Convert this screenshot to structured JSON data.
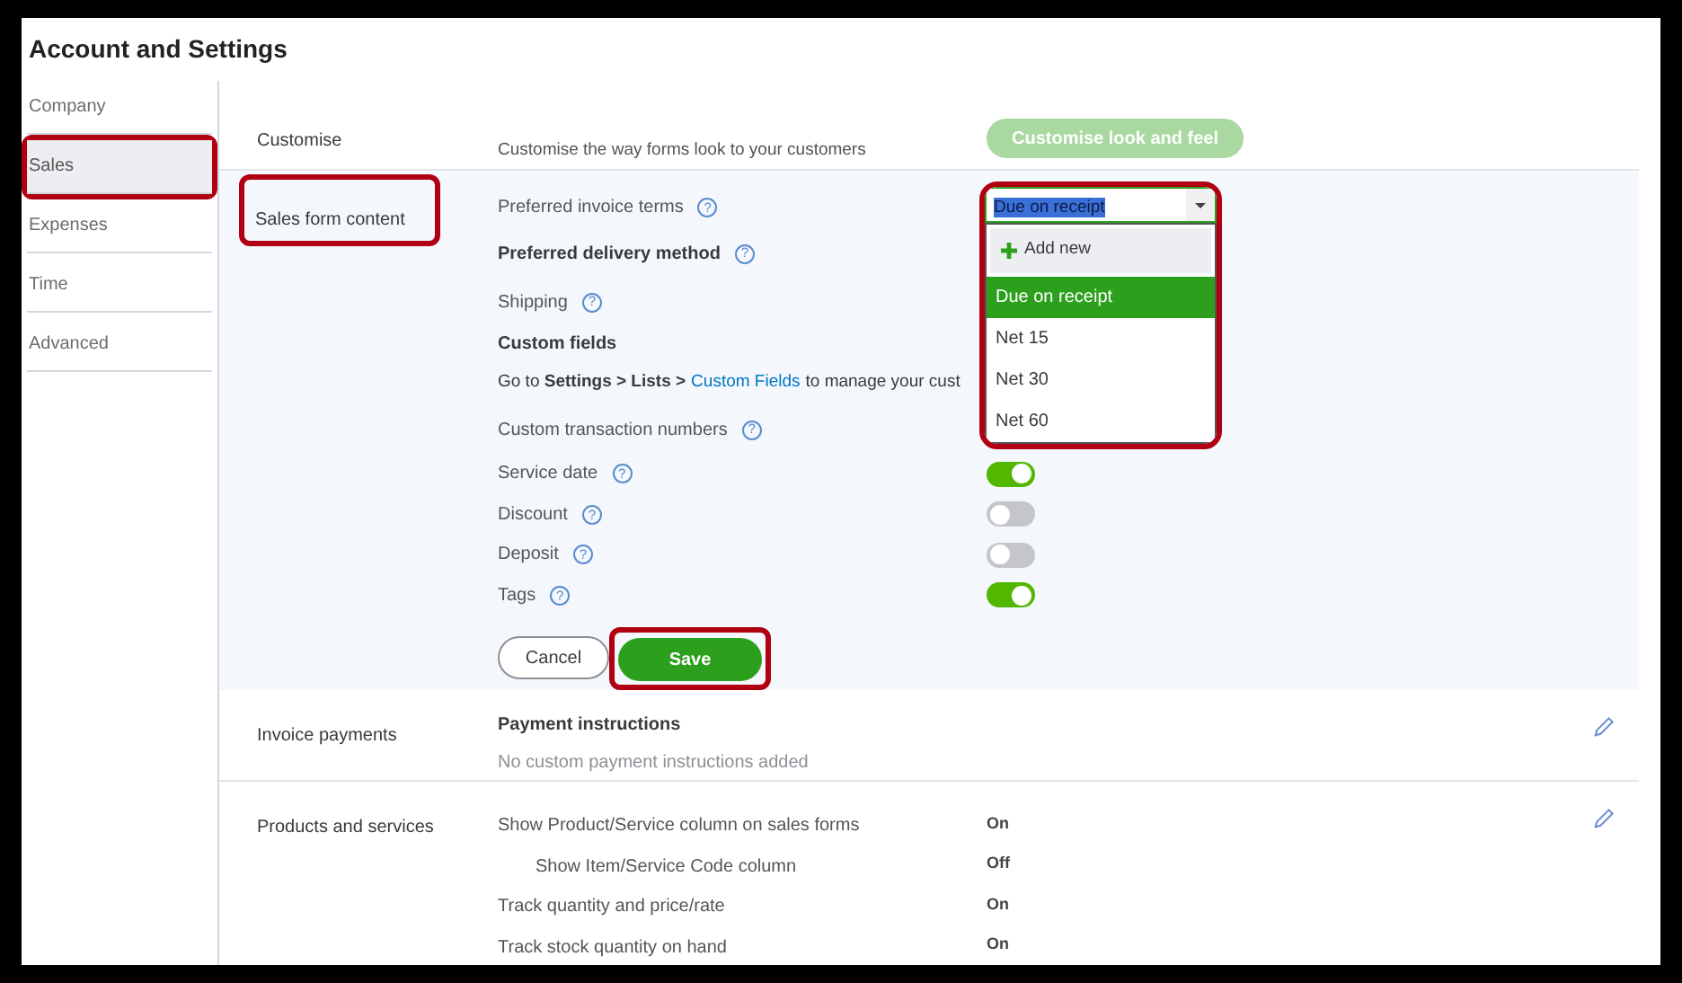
{
  "window": {
    "title": "Account and Settings"
  },
  "sidebar": {
    "items": [
      {
        "label": "Company",
        "selected": false,
        "highlighted": false
      },
      {
        "label": "Sales",
        "selected": true,
        "highlighted": true
      },
      {
        "label": "Expenses",
        "selected": false,
        "highlighted": false
      },
      {
        "label": "Time",
        "selected": false,
        "highlighted": false
      },
      {
        "label": "Advanced",
        "selected": false,
        "highlighted": false
      }
    ]
  },
  "customise": {
    "label": "Customise",
    "description": "Customise the way forms look to your customers",
    "button": "Customise look and feel",
    "disabled": true
  },
  "sales_form_content": {
    "label": "Sales form content",
    "highlighted": true,
    "invoice_terms": {
      "label": "Preferred invoice terms",
      "help": "?",
      "value": "Due on receipt",
      "highlighted": true,
      "add_new": "Add new",
      "options": [
        {
          "label": "Due on receipt",
          "selected": true
        },
        {
          "label": "Net 15",
          "selected": false
        },
        {
          "label": "Net 30",
          "selected": false
        },
        {
          "label": "Net 60",
          "selected": false
        }
      ]
    },
    "rows": [
      {
        "kind": "bold",
        "label": "Preferred delivery method",
        "help": "?"
      },
      {
        "kind": "plain",
        "label": "Shipping",
        "help": "?"
      },
      {
        "kind": "heading",
        "label": "Custom fields"
      },
      {
        "kind": "note",
        "prefix": "Go to **Settings > Lists >**",
        "link": "Custom Fields",
        "suffix": "to manage your cust"
      },
      {
        "kind": "plain",
        "label": "Custom transaction numbers",
        "help": "?"
      },
      {
        "kind": "toggle",
        "label": "Service date",
        "help": "?",
        "on": true
      },
      {
        "kind": "toggle",
        "label": "Discount",
        "help": "?",
        "on": false
      },
      {
        "kind": "toggle",
        "label": "Deposit",
        "help": "?",
        "on": false
      },
      {
        "kind": "toggle",
        "label": "Tags",
        "help": "?",
        "on": true
      }
    ],
    "cancel": "Cancel",
    "save": "Save",
    "save_highlighted": true
  },
  "invoice_payments": {
    "label": "Invoice payments",
    "title": "Payment instructions",
    "description": "No custom payment instructions added"
  },
  "products_and_services": {
    "label": "Products and services",
    "rows": [
      {
        "label": "Show Product/Service column on sales forms",
        "value": "On",
        "indented": false
      },
      {
        "label": "Show Item/Service Code column",
        "value": "Off",
        "indented": true
      },
      {
        "label": "Track quantity and price/rate",
        "value": "On",
        "indented": false
      },
      {
        "label": "Track stock quantity on hand",
        "value": "On",
        "indented": false
      }
    ]
  }
}
